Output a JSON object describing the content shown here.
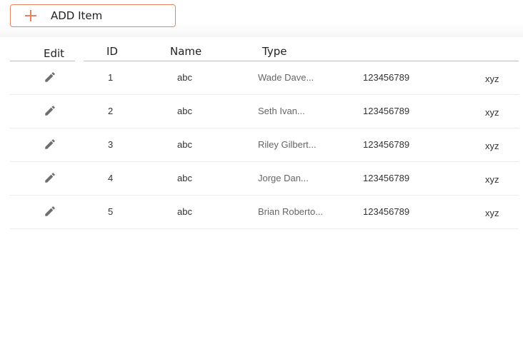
{
  "toolbar": {
    "add_label": "ADD Item",
    "icon": "plus-icon",
    "accent": "#e8825e"
  },
  "table": {
    "headers": {
      "edit": "Edit",
      "id": "ID",
      "name": "Name",
      "type": "Type"
    },
    "rows": [
      {
        "id": "1",
        "col2": "abc",
        "col3": "Wade Dave...",
        "col4": "123456789",
        "col5": "xyz"
      },
      {
        "id": "2",
        "col2": "abc",
        "col3": "Seth Ivan...",
        "col4": "123456789",
        "col5": "xyz"
      },
      {
        "id": "3",
        "col2": "abc",
        "col3": "Riley Gilbert...",
        "col4": "123456789",
        "col5": "xyz"
      },
      {
        "id": "4",
        "col2": "abc",
        "col3": "Jorge Dan...",
        "col4": "123456789",
        "col5": "xyz"
      },
      {
        "id": "5",
        "col2": "abc",
        "col3": "Brian Roberto...",
        "col4": "123456789",
        "col5": "xyz"
      }
    ]
  }
}
